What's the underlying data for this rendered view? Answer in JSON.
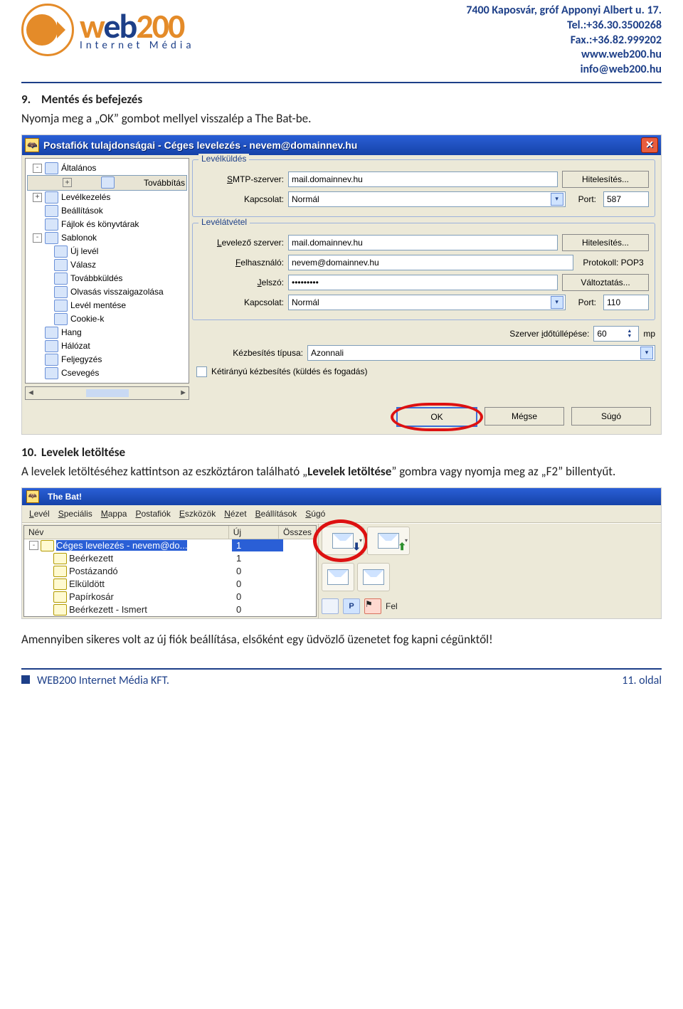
{
  "header": {
    "brand_main_w": "w",
    "brand_main_eb": "eb",
    "brand_main_200": "200",
    "brand_sub": "Internet Média",
    "contact": {
      "addr": "7400 Kaposvár, gróf Apponyi Albert u. 17.",
      "tel": "Tel.:+36.30.3500268",
      "fax": "Fax.:+36.82.999202",
      "web": "www.web200.hu",
      "email": "info@web200.hu"
    }
  },
  "section9": {
    "num": "9.",
    "title": "Mentés és befejezés",
    "text": "Nyomja meg a „OK” gombot mellyel visszalép a The Bat-be."
  },
  "dlg": {
    "title": "Postafiók tulajdonságai - Céges levelezés - nevem@domainnev.hu",
    "tree": [
      {
        "type": "root",
        "exp": "-",
        "label": "Általános"
      },
      {
        "type": "child",
        "exp": "+",
        "label": "Továbbítás",
        "sel": true
      },
      {
        "type": "child",
        "exp": "+",
        "label": "Levélkezelés"
      },
      {
        "type": "child",
        "exp": "",
        "label": "Beállítások"
      },
      {
        "type": "child",
        "exp": "",
        "label": "Fájlok és könyvtárak"
      },
      {
        "type": "child",
        "exp": "-",
        "label": "Sablonok"
      },
      {
        "type": "sub",
        "label": "Új levél"
      },
      {
        "type": "sub",
        "label": "Válasz"
      },
      {
        "type": "sub",
        "label": "Továbbküldés"
      },
      {
        "type": "sub",
        "label": "Olvasás visszaigazolása"
      },
      {
        "type": "sub",
        "label": "Levél mentése"
      },
      {
        "type": "sub",
        "label": "Cookie-k"
      },
      {
        "type": "child",
        "exp": "",
        "label": "Hang"
      },
      {
        "type": "child",
        "exp": "",
        "label": "Hálózat"
      },
      {
        "type": "child",
        "exp": "",
        "label": "Feljegyzés"
      },
      {
        "type": "child",
        "exp": "",
        "label": "Csevegés"
      }
    ],
    "send": {
      "legend": "Levélküldés",
      "smtp_label": "SMTP-szerver:",
      "smtp_value": "mail.domainnev.hu",
      "auth_btn": "Hitelesítés...",
      "conn_label": "Kapcsolat:",
      "conn_value": "Normál",
      "port_label": "Port:",
      "port_value": "587"
    },
    "recv": {
      "legend": "Levélátvétel",
      "srv_label": "Levelező szerver:",
      "srv_value": "mail.domainnev.hu",
      "auth_btn": "Hitelesítés...",
      "user_label": "Felhasználó:",
      "user_value": "nevem@domainnev.hu",
      "proto_label": "Protokoll: POP3",
      "pass_label": "Jelszó:",
      "pass_value": "•••••••••",
      "change_btn": "Változtatás...",
      "conn_label": "Kapcsolat:",
      "conn_value": "Normál",
      "port_label": "Port:",
      "port_value": "110"
    },
    "timeout_label": "Szerver időtúllépése:",
    "timeout_value": "60",
    "timeout_unit": "mp",
    "delivery_label": "Kézbesítés típusa:",
    "delivery_value": "Azonnali",
    "bidi": "Kétirányú kézbesítés (küldés és fogadás)",
    "buttons": {
      "ok": "OK",
      "cancel": "Mégse",
      "help": "Súgó"
    }
  },
  "section10": {
    "num": "10.",
    "title": "Levelek letöltése",
    "text_a": "A levelek letöltéséhez kattintson az eszköztáron található „",
    "text_b": "Levelek letöltése",
    "text_c": "” gombra vagy nyomja meg az „F2” billentyűt."
  },
  "bat": {
    "title": "The Bat!",
    "menu": [
      "Levél",
      "Speciális",
      "Mappa",
      "Postafiók",
      "Eszközök",
      "Nézet",
      "Beállítások",
      "Súgó"
    ],
    "cols": {
      "name": "Név",
      "new": "Új",
      "all": "Összes"
    },
    "rows": [
      {
        "exp": "-",
        "label": "Céges levelezés - nevem@do...",
        "new": "1",
        "sel": true,
        "indent": 0
      },
      {
        "label": "Beérkezett",
        "new": "1",
        "indent": 1
      },
      {
        "label": "Postázandó",
        "new": "0",
        "indent": 1
      },
      {
        "label": "Elküldött",
        "new": "0",
        "indent": 1
      },
      {
        "label": "Papírkosár",
        "new": "0",
        "indent": 1
      },
      {
        "label": "Beérkezett - Ismert",
        "new": "0",
        "indent": 1
      }
    ],
    "fel": "Fel"
  },
  "closing": "Amennyiben sikeres volt az új fiók beállítása, elsőként egy üdvözlő üzenetet fog kapni cégünktől!",
  "footer": {
    "company": "WEB200 Internet Média KFT.",
    "page": "11. oldal"
  }
}
